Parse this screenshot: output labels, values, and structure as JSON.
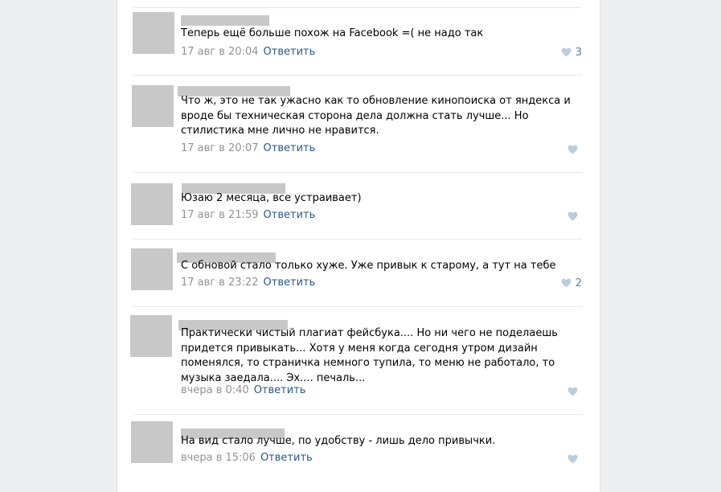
{
  "icons": {
    "like": "heart-icon"
  },
  "colors": {
    "page_bg": "#edeef0",
    "card_bg": "#ffffff",
    "link": "#2a5885",
    "meta": "#939393",
    "heart": "#b9cde0",
    "placeholder": "#c8c8c8"
  },
  "comments": [
    {
      "text": "Теперь ещё больше похож на Facebook =( не надо так",
      "date": "17 авг в 20:04",
      "reply_label": "Ответить",
      "likes": "3"
    },
    {
      "text": "Что ж, это не так ужасно как то обновление кинопоиска от яндекса и вроде бы техническая сторона дела должна стать лучше... Но стилистика мне лично не нравится.",
      "date": "17 авг в 20:07",
      "reply_label": "Ответить",
      "likes": ""
    },
    {
      "text": "Юзаю 2 месяца, все устраивает)",
      "date": "17 авг в 21:59",
      "reply_label": "Ответить",
      "likes": ""
    },
    {
      "text": "С обновой стало только хуже. Уже привык к старому, а тут на тебе",
      "date": "17 авг в 23:22",
      "reply_label": "Ответить",
      "likes": "2"
    },
    {
      "text": "Практически чистый плагиат фейсбука.... Но ни чего не поделаешь придется привыкать... Хотя у меня когда сегодня утром дизайн поменялся, то страничка немного тупила, то меню не работало, то музыка заедала.... Эх.... печаль...",
      "date": "вчера в 0:40",
      "reply_label": "Ответить",
      "likes": ""
    },
    {
      "text": "На вид стало лучше, по удобству - лишь дело привычки.",
      "date": "вчера в 15:06",
      "reply_label": "Ответить",
      "likes": ""
    }
  ]
}
